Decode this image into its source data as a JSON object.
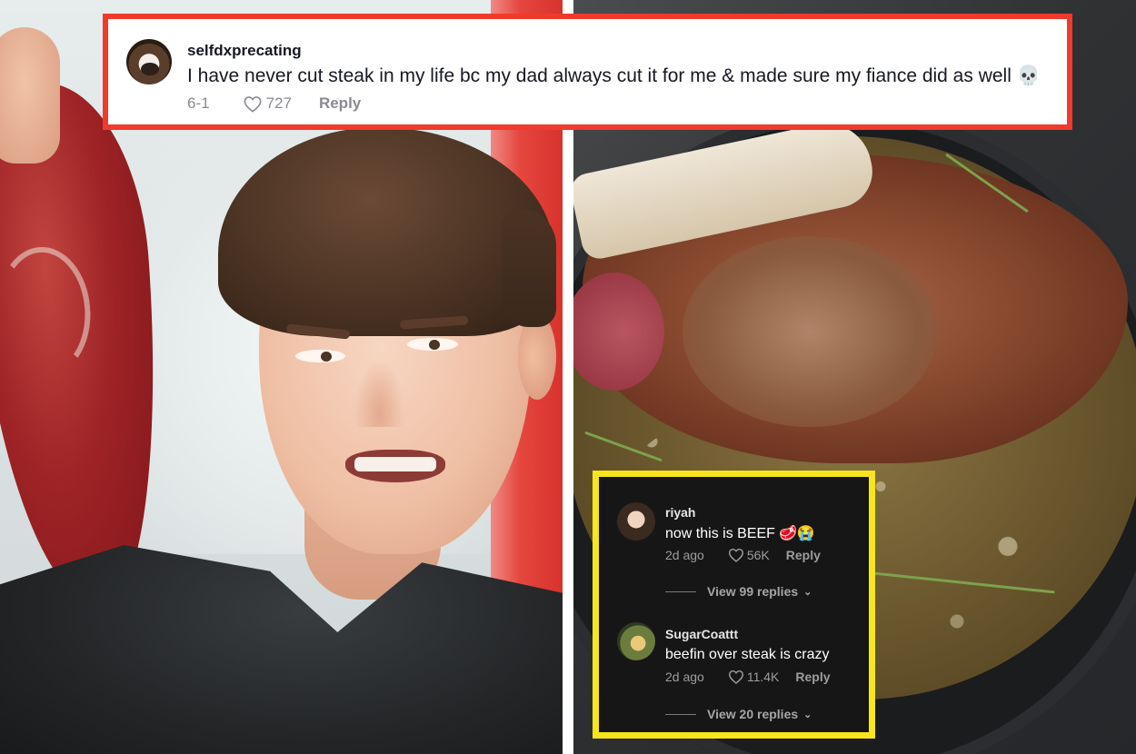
{
  "top_comment": {
    "username": "selfdxprecating",
    "text": "I have never cut steak in my life bc my dad always cut it for me & made sure my fiance did as well",
    "emoji": "💀",
    "date": "6-1",
    "likes": "727",
    "reply_label": "Reply",
    "border_color": "#ef3b2c"
  },
  "dark_card": {
    "border_color": "#f7e61a",
    "comments": [
      {
        "username": "riyah",
        "text": "now this is BEEF",
        "emoji": "🥩😭",
        "date": "2d ago",
        "likes": "56K",
        "reply_label": "Reply",
        "view_replies": "View 99 replies"
      },
      {
        "username": "SugarCoattt",
        "text": "beefin over steak is crazy",
        "date": "2d ago",
        "likes": "11.4K",
        "reply_label": "Reply",
        "view_replies": "View 20 replies"
      }
    ]
  }
}
